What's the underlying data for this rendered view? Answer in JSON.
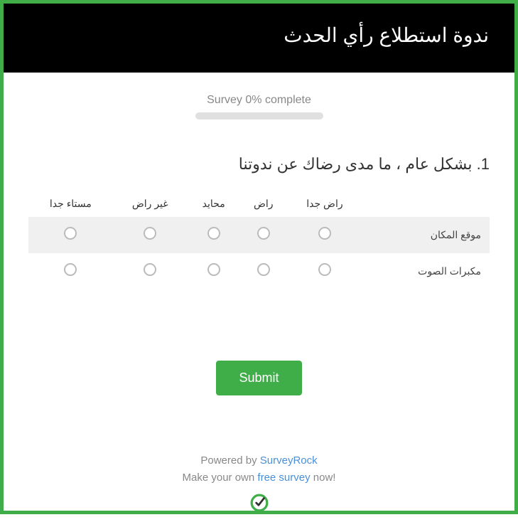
{
  "header": {
    "title": "ندوة استطلاع رأي الحدث"
  },
  "progress": {
    "label": "Survey 0% complete",
    "percent": 0
  },
  "question": {
    "number": "1.",
    "text": "بشكل عام ، ما مدى رضاك عن ندوتنا",
    "columns": [
      "راض جدا",
      "راض",
      "محايد",
      "غير راض",
      "مستاء جدا"
    ],
    "rows": [
      "موقع المكان",
      "مكبرات الصوت"
    ]
  },
  "submit": {
    "label": "Submit"
  },
  "footer": {
    "powered_prefix": "Powered by ",
    "powered_link": "SurveyRock",
    "make_prefix": "Make your own ",
    "make_link": "free survey",
    "make_suffix": " now!"
  }
}
